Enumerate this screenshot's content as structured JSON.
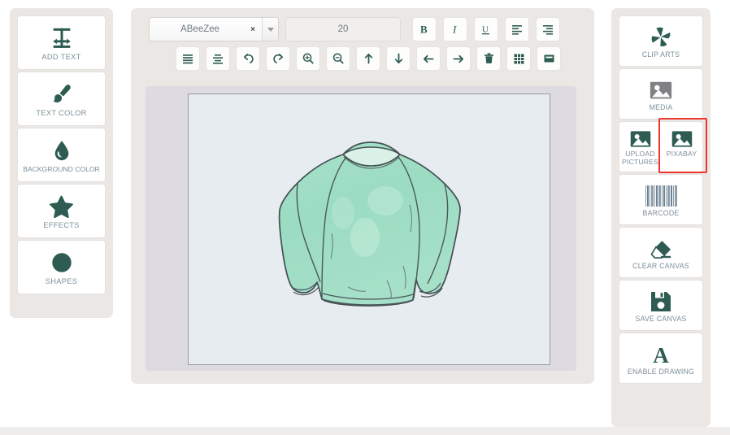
{
  "app": {
    "accent_color": "#2f5c52",
    "label_color": "#7d8f9a",
    "panel_bg": "#eae7e4",
    "canvas_mat": "#dedae2",
    "canvas_bg": "#e7ecf1",
    "highlight_color": "#f0342e",
    "disabled_icon_color": "#808184"
  },
  "left_toolbar": {
    "items": [
      {
        "label": "ADD TEXT",
        "icon": "text-resize-icon"
      },
      {
        "label": "TEXT COLOR",
        "icon": "paint-brush-icon"
      },
      {
        "label": "BACKGROUND COLOR",
        "icon": "water-drop-icon"
      },
      {
        "label": "EFFECTS",
        "icon": "star-icon"
      },
      {
        "label": "SHAPES",
        "icon": "circle-icon"
      }
    ]
  },
  "toolbar": {
    "font_family": {
      "value": "ABeeZee",
      "clear_label": "×"
    },
    "font_size": {
      "value": "20",
      "placeholder": "20"
    },
    "row1_buttons": [
      {
        "name": "bold",
        "label": "B",
        "icon": "bold-icon"
      },
      {
        "name": "italic",
        "label": "I",
        "icon": "italic-icon"
      },
      {
        "name": "underline",
        "label": "U",
        "icon": "underline-icon"
      },
      {
        "name": "align-left",
        "label": "",
        "icon": "align-left-icon"
      },
      {
        "name": "align-right",
        "label": "",
        "icon": "align-right-icon"
      }
    ],
    "row2_buttons": [
      {
        "name": "align-justify",
        "icon": "align-justify-icon"
      },
      {
        "name": "align-center",
        "icon": "align-center-icon"
      },
      {
        "name": "undo",
        "icon": "undo-icon"
      },
      {
        "name": "redo",
        "icon": "redo-icon"
      },
      {
        "name": "zoom-in",
        "icon": "zoom-in-icon"
      },
      {
        "name": "zoom-out",
        "icon": "zoom-out-icon"
      },
      {
        "name": "move-up",
        "icon": "arrow-up-icon"
      },
      {
        "name": "move-down",
        "icon": "arrow-down-icon"
      },
      {
        "name": "move-left",
        "icon": "arrow-left-icon"
      },
      {
        "name": "move-right",
        "icon": "arrow-right-icon"
      },
      {
        "name": "delete",
        "icon": "trash-icon"
      },
      {
        "name": "grid",
        "icon": "grid-icon"
      },
      {
        "name": "fullscreen",
        "icon": "rectangle-icon"
      }
    ]
  },
  "canvas": {
    "artwork": "green-long-sleeve-sweater-sketch",
    "artwork_fill": "#9fdcc4",
    "artwork_stroke": "#3f4b4f"
  },
  "right_toolbar": {
    "items": [
      {
        "label": "CLIP ARTS",
        "icon": "clip-arts-icon",
        "state": "enabled"
      },
      {
        "label": "MEDIA",
        "icon": "media-image-icon",
        "state": "disabled"
      },
      {
        "label": "BARCODE",
        "icon": "barcode-icon",
        "state": "enabled"
      },
      {
        "label": "CLEAR CANVAS",
        "icon": "eraser-icon",
        "state": "enabled"
      },
      {
        "label": "SAVE CANVAS",
        "icon": "floppy-disk-icon",
        "state": "enabled"
      },
      {
        "label": "ENABLE DRAWING",
        "icon": "letter-a-icon",
        "state": "enabled"
      }
    ],
    "split_row": {
      "left": {
        "label_line1": "UPLOAD",
        "label_line2": "PICTURES",
        "icon": "upload-picture-icon"
      },
      "right": {
        "label": "PIXABAY",
        "icon": "pixabay-image-icon",
        "highlighted": true
      }
    }
  }
}
